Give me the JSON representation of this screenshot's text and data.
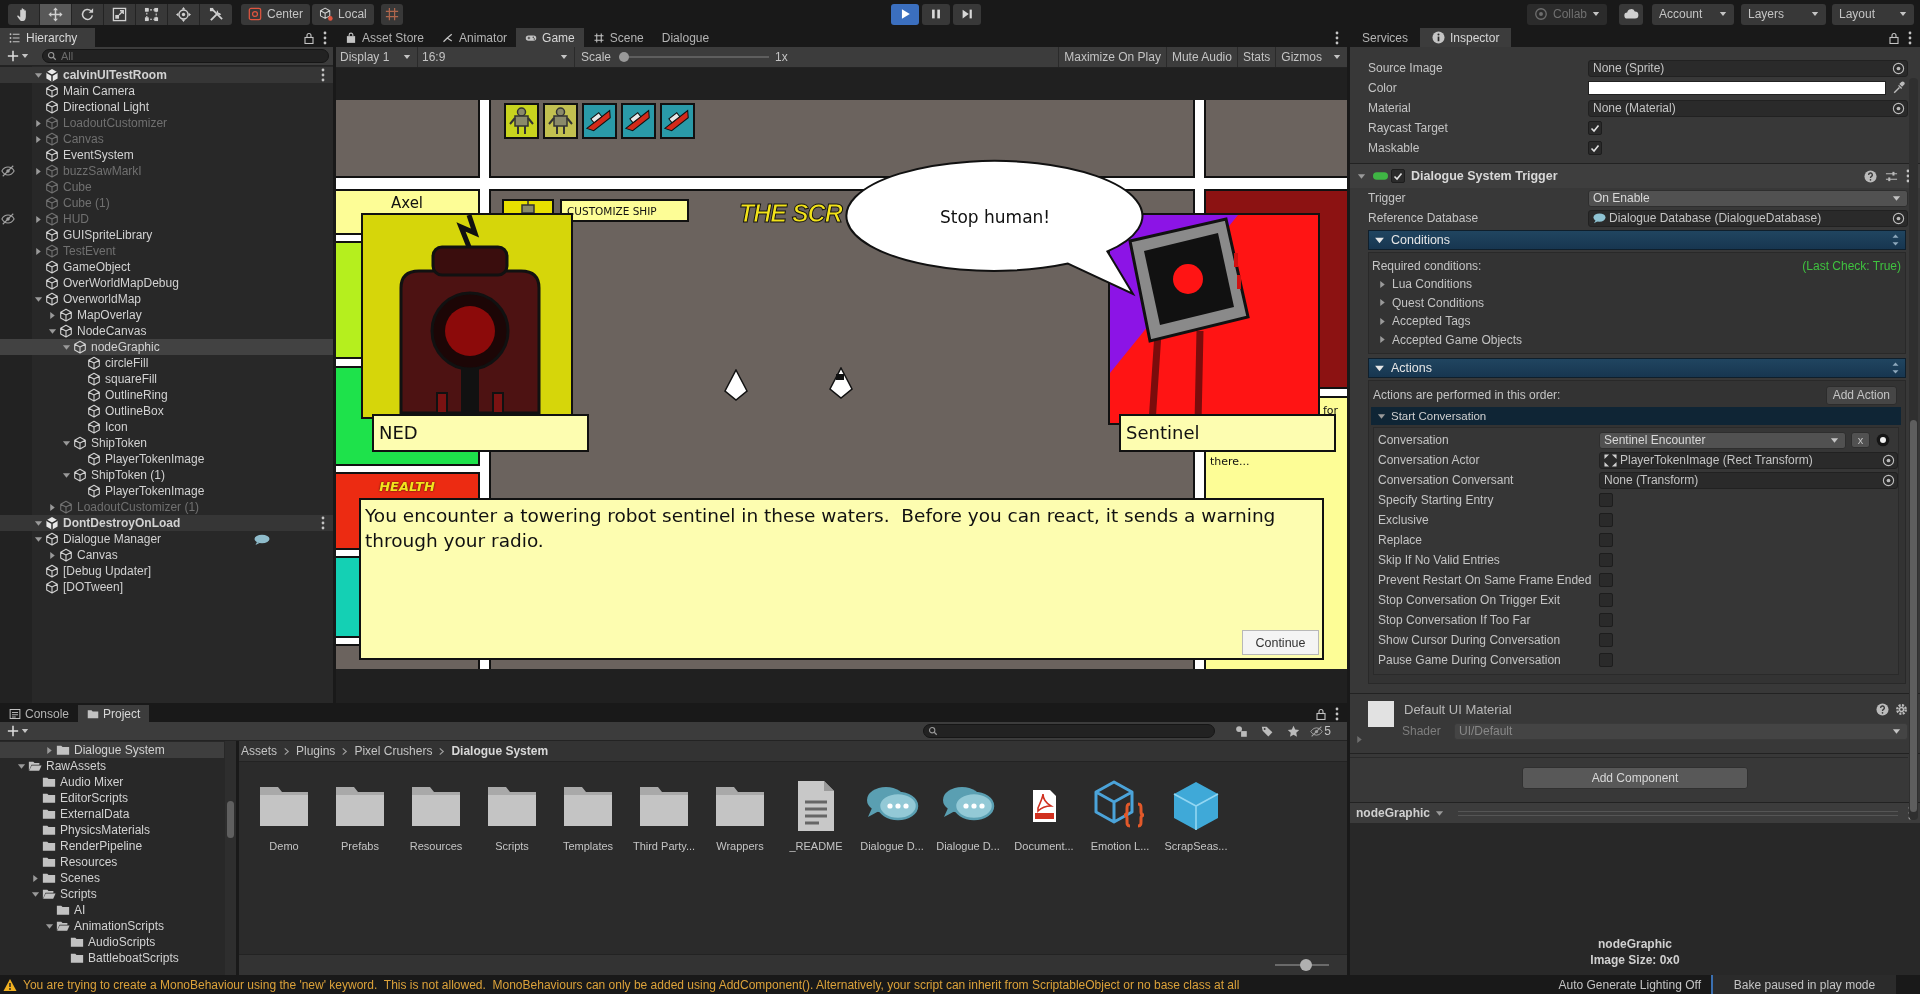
{
  "toolbar": {
    "tools": [
      {
        "kind": "hand",
        "selected": false
      },
      {
        "kind": "move",
        "selected": true
      },
      {
        "kind": "rotate",
        "selected": false
      },
      {
        "kind": "scale",
        "selected": false
      },
      {
        "kind": "rect",
        "selected": false
      },
      {
        "kind": "transform",
        "selected": false
      },
      {
        "kind": "custom",
        "selected": false
      }
    ],
    "pivot": "Center",
    "space": "Local",
    "playback": [
      {
        "kind": "play",
        "selected": true
      },
      {
        "kind": "pause",
        "selected": false
      },
      {
        "kind": "step",
        "selected": false
      }
    ],
    "collab": {
      "label": "Collab",
      "disabled": true
    },
    "account": "Account",
    "layers": "Layers",
    "layout": "Layout"
  },
  "hierarchy": {
    "title": "Hierarchy",
    "search_placeholder": "All",
    "scenes": [
      {
        "name": "calvinUITestRoom",
        "expanded": true,
        "items": [
          {
            "name": "Main Camera",
            "active": true,
            "selected": false
          },
          {
            "name": "Directional Light",
            "active": true,
            "selected": false
          },
          {
            "name": "LoadoutCustomizer",
            "active": false,
            "selected": false,
            "expanded": false
          },
          {
            "name": "Canvas",
            "active": false,
            "selected": false,
            "expanded": false
          },
          {
            "name": "EventSystem",
            "active": true,
            "selected": false
          },
          {
            "name": "buzzSawMarkI",
            "active": false,
            "selected": false,
            "expanded": false,
            "hidden": true
          },
          {
            "name": "Cube",
            "active": false,
            "selected": false
          },
          {
            "name": "Cube (1)",
            "active": false,
            "selected": false
          },
          {
            "name": "HUD",
            "active": false,
            "selected": false,
            "expanded": false,
            "hidden": true
          },
          {
            "name": "GUISpriteLibrary",
            "active": true,
            "selected": false
          },
          {
            "name": "TestEvent",
            "active": false,
            "selected": false,
            "expanded": false
          },
          {
            "name": "GameObject",
            "active": true,
            "selected": false
          },
          {
            "name": "OverWorldMapDebug",
            "active": true,
            "selected": false
          },
          {
            "name": "OverworldMap",
            "active": true,
            "selected": false,
            "expanded": true,
            "children": [
              {
                "name": "MapOverlay",
                "active": true,
                "selected": false,
                "expanded": false
              },
              {
                "name": "NodeCanvas",
                "active": true,
                "selected": false,
                "expanded": true,
                "children": [
                  {
                    "name": "nodeGraphic",
                    "active": true,
                    "selected": true,
                    "expanded": true,
                    "children": [
                      {
                        "name": "circleFill",
                        "active": true,
                        "selected": false
                      },
                      {
                        "name": "squareFill",
                        "active": true,
                        "selected": false
                      },
                      {
                        "name": "OutlineRing",
                        "active": true,
                        "selected": false
                      },
                      {
                        "name": "OutlineBox",
                        "active": true,
                        "selected": false
                      },
                      {
                        "name": "Icon",
                        "active": true,
                        "selected": false
                      }
                    ]
                  },
                  {
                    "name": "ShipToken",
                    "active": true,
                    "selected": false,
                    "expanded": true,
                    "children": [
                      {
                        "name": "PlayerTokenImage",
                        "active": true,
                        "selected": false
                      }
                    ]
                  },
                  {
                    "name": "ShipToken (1)",
                    "active": true,
                    "selected": false,
                    "expanded": true,
                    "children": [
                      {
                        "name": "PlayerTokenImage",
                        "active": true,
                        "selected": false
                      }
                    ]
                  }
                ]
              },
              {
                "name": "LoadoutCustomizer (1)",
                "active": false,
                "selected": false,
                "expanded": false
              }
            ]
          }
        ]
      },
      {
        "name": "DontDestroyOnLoad",
        "expanded": true,
        "items": [
          {
            "name": "Dialogue Manager",
            "active": true,
            "selected": false,
            "expanded": true,
            "gizmo": true,
            "children": [
              {
                "name": "Canvas",
                "active": true,
                "selected": false,
                "expanded": false
              }
            ]
          },
          {
            "name": "[Debug Updater]",
            "active": true,
            "selected": false
          },
          {
            "name": "[DOTween]",
            "active": true,
            "selected": false
          }
        ]
      }
    ]
  },
  "game_view": {
    "tabs": [
      {
        "label": "Asset Store",
        "kind": "store",
        "selected": false
      },
      {
        "label": "Animator",
        "kind": "animator",
        "selected": false
      },
      {
        "label": "Game",
        "kind": "game",
        "selected": true
      },
      {
        "label": "Scene",
        "kind": "scene",
        "selected": false
      },
      {
        "label": "Dialogue",
        "kind": "plain",
        "selected": false
      }
    ],
    "display": "Display 1",
    "aspect": "16:9",
    "scale_label": "Scale",
    "scale": {
      "level": 0
    },
    "scale_value": "1x",
    "toggles": [
      {
        "label": "Maximize On Play",
        "on": false
      },
      {
        "label": "Mute Audio",
        "on": false
      },
      {
        "label": "Stats",
        "on": false
      },
      {
        "label": "Gizmos",
        "on": false
      }
    ],
    "screen": {
      "left_panel_name": "Axel",
      "health_label": "HEALTH",
      "menu_button": "CUSTOMIZE SHIP",
      "title_fragment": "THE SCR",
      "speech": "Stop human!",
      "speakers": [
        {
          "name": "NED",
          "kind": "left"
        },
        {
          "name": "Sentinel",
          "kind": "right"
        }
      ],
      "right_fragments": [
        "for",
        "there..."
      ],
      "dialogue": "You encounter a towering robot sentinel in these waters.  Before you can react, it sends a warning through your radio.",
      "continue": "Continue"
    }
  },
  "inspector": {
    "tabs": [
      {
        "label": "Services",
        "kind": "plain",
        "selected": false
      },
      {
        "label": "Inspector",
        "kind": "info",
        "selected": true
      }
    ],
    "image_fields": [
      {
        "kind": "object",
        "label": "Source Image",
        "value": "None (Sprite)"
      },
      {
        "kind": "color",
        "label": "Color",
        "color": "#ffffff"
      },
      {
        "kind": "object",
        "label": "Material",
        "value": "None (Material)"
      },
      {
        "kind": "checkbox",
        "label": "Raycast Target",
        "checked": true
      },
      {
        "kind": "checkbox",
        "label": "Maskable",
        "checked": true
      }
    ],
    "component": {
      "title": "Dialogue System Trigger",
      "enabled": true,
      "expanded": true,
      "fields": [
        {
          "kind": "dropdown",
          "label": "Trigger",
          "value": "On Enable"
        },
        {
          "kind": "database_object",
          "label": "Reference Database",
          "value": "Dialogue Database (DialogueDatabase)"
        }
      ],
      "conditions": {
        "title": "Conditions",
        "expanded": true,
        "heading": "Required conditions:",
        "last_check": "(Last Check: True)",
        "foldouts": [
          {
            "label": "Lua Conditions",
            "expanded": false
          },
          {
            "label": "Quest Conditions",
            "expanded": false
          },
          {
            "label": "Accepted Tags",
            "expanded": false
          },
          {
            "label": "Accepted Game Objects",
            "expanded": false
          }
        ]
      },
      "actions": {
        "title": "Actions",
        "expanded": true,
        "note": "Actions are performed in this order:",
        "add_button": "Add Action",
        "action": {
          "title": "Start Conversation",
          "expanded": true,
          "fields": [
            {
              "kind": "dropdown_clear",
              "label": "Conversation",
              "value": "Sentinel Encounter",
              "clear": "x"
            },
            {
              "kind": "transform_object",
              "label": "Conversation Actor",
              "value": "PlayerTokenImage (Rect Transform)"
            },
            {
              "kind": "object",
              "label": "Conversation Conversant",
              "value": "None (Transform)"
            },
            {
              "kind": "checkbox",
              "label": "Specify Starting Entry",
              "checked": false
            },
            {
              "kind": "checkbox",
              "label": "Exclusive",
              "checked": false
            },
            {
              "kind": "checkbox",
              "label": "Replace",
              "checked": false
            },
            {
              "kind": "checkbox",
              "label": "Skip If No Valid Entries",
              "checked": false
            },
            {
              "kind": "checkbox",
              "label": "Prevent Restart On Same Frame Ended",
              "checked": false
            },
            {
              "kind": "checkbox",
              "label": "Stop Conversation On Trigger Exit",
              "checked": false
            },
            {
              "kind": "checkbox",
              "label": "Stop Conversation If Too Far",
              "checked": false
            },
            {
              "kind": "checkbox",
              "label": "Show Cursor During Conversation",
              "checked": false
            },
            {
              "kind": "checkbox",
              "label": "Pause Game During Conversation",
              "checked": false
            }
          ]
        }
      }
    },
    "material": {
      "name": "Default UI Material",
      "expanded": false,
      "shader_label": "Shader",
      "shader": "UI/Default"
    },
    "add_component": "Add Component",
    "preview": {
      "title": "nodeGraphic",
      "name": "nodeGraphic",
      "info": "Image Size: 0x0"
    }
  },
  "bottom_tabs": [
    {
      "label": "Console",
      "kind": "console",
      "selected": false
    },
    {
      "label": "Project",
      "kind": "folder",
      "selected": true
    }
  ],
  "project": {
    "hidden_count": "5",
    "top_row": {
      "name": "Dialogue System",
      "expanded": false,
      "selected": true
    },
    "tree": [
      {
        "name": "RawAssets",
        "expanded": true,
        "selected": false,
        "children": [
          {
            "name": "Audio Mixer",
            "selected": false
          },
          {
            "name": "EditorScripts",
            "selected": false
          },
          {
            "name": "ExternalData",
            "selected": false
          },
          {
            "name": "PhysicsMaterials",
            "selected": false
          },
          {
            "name": "RenderPipeline",
            "selected": false
          },
          {
            "name": "Resources",
            "selected": false
          },
          {
            "name": "Scenes",
            "expanded": false,
            "selected": false
          },
          {
            "name": "Scripts",
            "expanded": true,
            "selected": false,
            "children": [
              {
                "name": "AI",
                "selected": false
              },
              {
                "name": "AnimationScripts",
                "expanded": true,
                "selected": false,
                "children": [
                  {
                    "name": "AudioScripts",
                    "selected": false
                  },
                  {
                    "name": "BattleboatScripts",
                    "selected": false
                  }
                ]
              }
            ]
          }
        ]
      }
    ],
    "breadcrumbs": [
      {
        "label": "Assets",
        "current": false
      },
      {
        "label": "Plugins",
        "current": false
      },
      {
        "label": "Pixel Crushers",
        "current": false
      },
      {
        "label": "Dialogue System",
        "current": true
      }
    ],
    "assets": [
      {
        "kind": "folder",
        "name": "Demo"
      },
      {
        "kind": "folder",
        "name": "Prefabs"
      },
      {
        "kind": "folder",
        "name": "Resources"
      },
      {
        "kind": "folder",
        "name": "Scripts"
      },
      {
        "kind": "folder",
        "name": "Templates"
      },
      {
        "kind": "folder",
        "name": "Third Party..."
      },
      {
        "kind": "folder",
        "name": "Wrappers"
      },
      {
        "kind": "text",
        "name": "_README"
      },
      {
        "kind": "dialogue",
        "name": "Dialogue D..."
      },
      {
        "kind": "dialogue",
        "name": "Dialogue D..."
      },
      {
        "kind": "pdf",
        "name": "Document..."
      },
      {
        "kind": "script",
        "name": "Emotion L..."
      },
      {
        "kind": "prefab",
        "name": "ScrapSeas..."
      }
    ],
    "icon_size": {
      "level": 0.6
    }
  },
  "status_bar": {
    "message": "You are trying to create a MonoBehaviour using the 'new' keyword.  This is not allowed.  MonoBehaviours can only be added using AddComponent(). Alternatively, your script can inherit from ScriptableObject or no base class at all",
    "lighting": "Auto Generate Lighting Off",
    "bake": "Bake paused in play mode"
  }
}
